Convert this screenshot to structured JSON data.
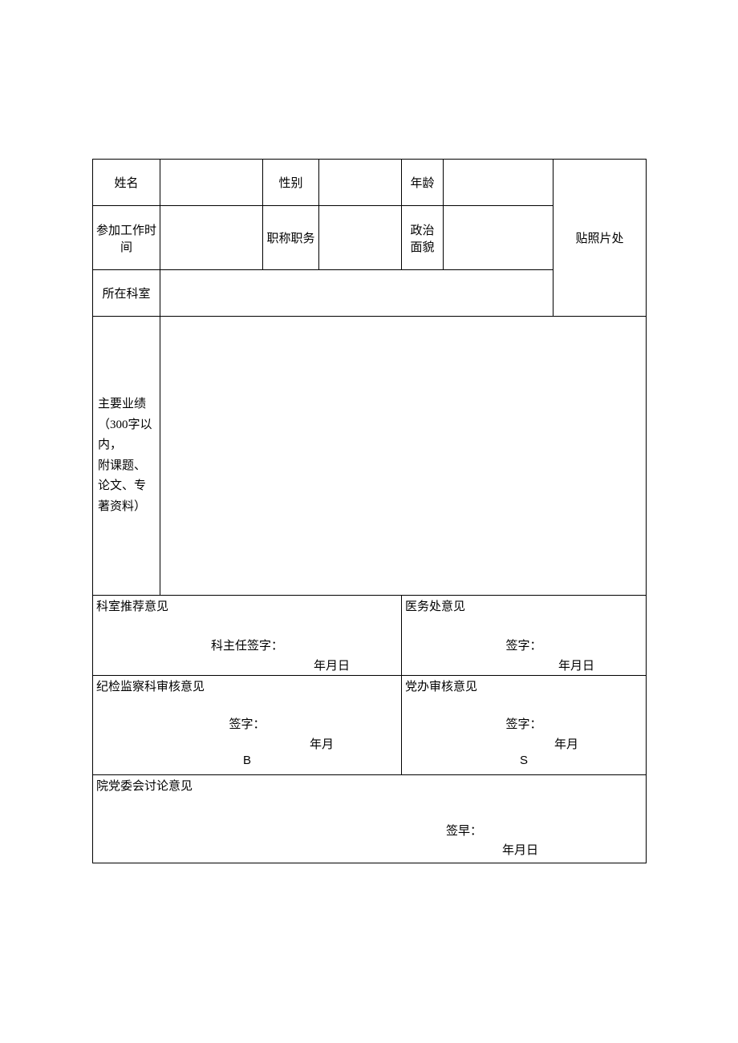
{
  "labels": {
    "name": "姓名",
    "gender": "性别",
    "age": "年龄",
    "work_start": "参加工作时间",
    "title_position": "职称职务",
    "political": "政治面貌",
    "department": "所在科室",
    "photo": "贴照片处",
    "achievements": "主要业绩\n（300字以内，\n附课题、论文、专著资料）"
  },
  "values": {
    "name": "",
    "gender": "",
    "age": "",
    "work_start": "",
    "title_position": "",
    "political": "",
    "department": "",
    "achievements": ""
  },
  "opinions": {
    "dept_recommend": {
      "title": "科室推荐意见",
      "sig_label": "科主任签字：",
      "date": "年月日"
    },
    "medical_office": {
      "title": "医务处意见",
      "sig_label": "签字：",
      "date": "年月日"
    },
    "discipline": {
      "title": "纪检监察科审核意见",
      "sig_label": "签字：",
      "date": "年月",
      "letter": "B"
    },
    "party_office": {
      "title": "党办审核意见",
      "sig_label": "签字：",
      "date": "年月",
      "letter": "S"
    },
    "committee": {
      "title": "院党委会讨论意见",
      "sig_label": "签早：",
      "date": "年月日"
    }
  }
}
